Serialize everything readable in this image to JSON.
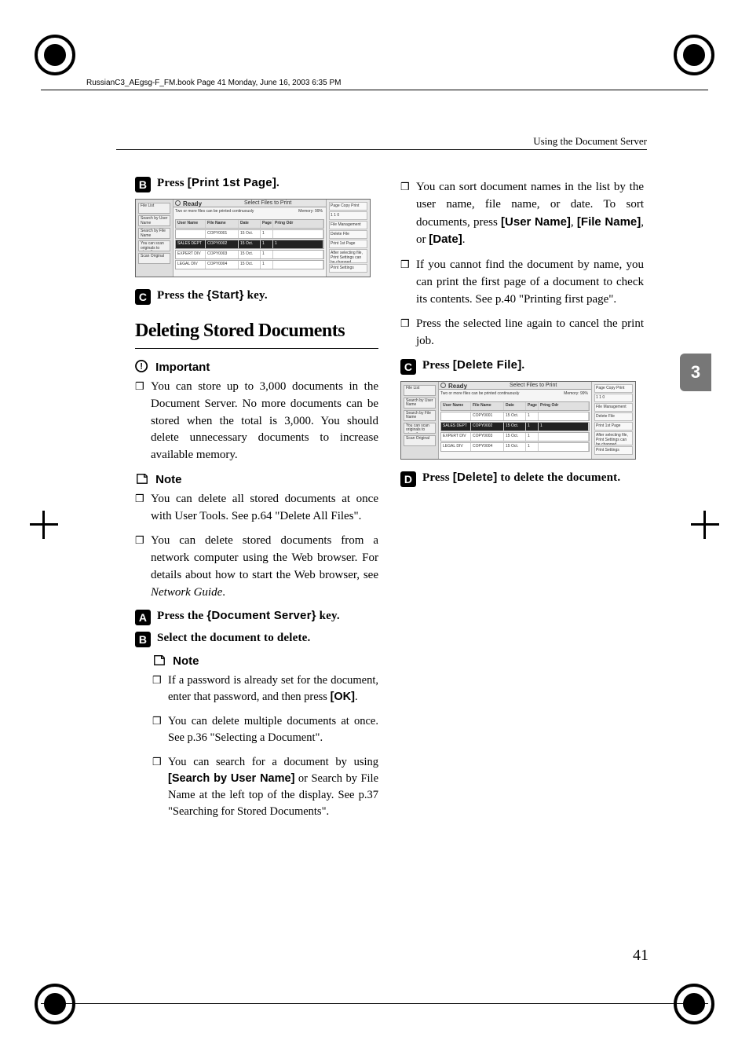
{
  "book_header": "RussianC3_AEgsg-F_FM.book  Page 41  Monday, June 16, 2003  6:35 PM",
  "running_head": "Using the Document Server",
  "page_number": "41",
  "chapter_tab": "3",
  "left": {
    "step2_prefix": "Press ",
    "step2_ui": "[Print 1st Page]",
    "step2_suffix": ".",
    "step3_prefix": "Press the ",
    "step3_key_open": "{",
    "step3_key": "Start",
    "step3_key_close": "}",
    "step3_suffix": " key.",
    "h2": "Deleting Stored Documents",
    "important_label": "Important",
    "important_p1": "You can store up to 3,000 documents in the Document Server. No more documents can be stored when the total is 3,000. You should delete unnecessary documents to increase available memory.",
    "note_label": "Note",
    "note_p1": "You can delete all stored documents at once with User Tools. See p.64 \"Delete All Files\".",
    "note_p2a": "You can delete stored documents from a network computer using the Web browser. For details about how to start the Web browser, see ",
    "note_p2b": "Network Guide",
    "note_p2c": ".",
    "step1_prefix": "Press the ",
    "step1_key": "Document Server",
    "step1_suffix": " key.",
    "step2b": "Select the document to delete.",
    "sub_note_label": "Note",
    "sub_note_p1a": "If a password is already set for the document, enter that password, and then press ",
    "sub_note_p1b": "[OK]",
    "sub_note_p1c": ".",
    "sub_note_p2": "You can delete multiple documents at once. See p.36 \"Selecting a Document\".",
    "sub_note_p3a": "You can search for a document by using ",
    "sub_note_p3b": "[Search by User Name]",
    "sub_note_p3c": " or Search by File Name at the left top of the display. See p.37 \"Searching for Stored Documents\"."
  },
  "right": {
    "p1a": "You can sort document names in the list by the user name, file name, or date. To sort documents, press ",
    "p1b": "[User Name]",
    "p1c": ", ",
    "p1d": "[File Name]",
    "p1e": ", or ",
    "p1f": "[Date]",
    "p1g": ".",
    "p2": "If you cannot find the document by name, you can print the first page of a document to check its contents. See p.40 \"Printing first page\".",
    "p3": "Press the selected line again to cancel the print job.",
    "step3_prefix": "Press ",
    "step3_ui": "[Delete File]",
    "step3_suffix": ".",
    "step4_prefix": "Press ",
    "step4_ui": "[Delete]",
    "step4_suffix": " to delete the document."
  },
  "shot1": {
    "ready": "Ready",
    "title": "Select Files to Print",
    "side": [
      "File List",
      "Search by User Name",
      "Search by File Name",
      "You can scan originals to store them.",
      "Scan Original"
    ],
    "headers": [
      "User Name",
      "File Name",
      "Date",
      "Page",
      "Prtng Odr"
    ],
    "rows": [
      [
        "",
        "COPY0001",
        "15 Oct.",
        "1",
        ""
      ],
      [
        "SALES DEPT",
        "COPY0002",
        "15 Oct.",
        "1",
        "1"
      ],
      [
        "EXPERT DIV",
        "COPY0003",
        "15 Oct.",
        "1",
        ""
      ],
      [
        "LEGAL DIV",
        "COPY0004",
        "15 Oct.",
        "1",
        ""
      ]
    ],
    "rightcol": [
      "Page  Copy  Print",
      "1   1   0",
      "File Management",
      "Delete File",
      "Print 1st Page",
      "After selecting file, Print Settings can be changed.",
      "Print Settings"
    ],
    "sub": "Two or more files can be printed continuously",
    "mem": "Memory: 99%"
  },
  "shot2": {
    "ready": "Ready",
    "title": "Select Files to Print",
    "side": [
      "File List",
      "Search by User Name",
      "Search by File Name",
      "You can scan originals to store them.",
      "Scan Original"
    ],
    "headers": [
      "User Name",
      "File Name",
      "Date",
      "Page",
      "Prtng Odr"
    ],
    "rows": [
      [
        "",
        "COPY0001",
        "15 Oct.",
        "1",
        ""
      ],
      [
        "SALES DEPT",
        "COPY0002",
        "15 Oct.",
        "1",
        "1"
      ],
      [
        "EXPERT DIV",
        "COPY0003",
        "15 Oct.",
        "1",
        ""
      ],
      [
        "LEGAL DIV",
        "COPY0004",
        "15 Oct.",
        "1",
        ""
      ]
    ],
    "rightcol": [
      "Page  Copy  Print",
      "1   1   0",
      "File Management",
      "Delete File",
      "Print 1st Page",
      "After selecting file, Print Settings can be changed.",
      "Print Settings"
    ],
    "sub": "Two or more files can be printed continuously",
    "mem": "Memory: 99%"
  }
}
